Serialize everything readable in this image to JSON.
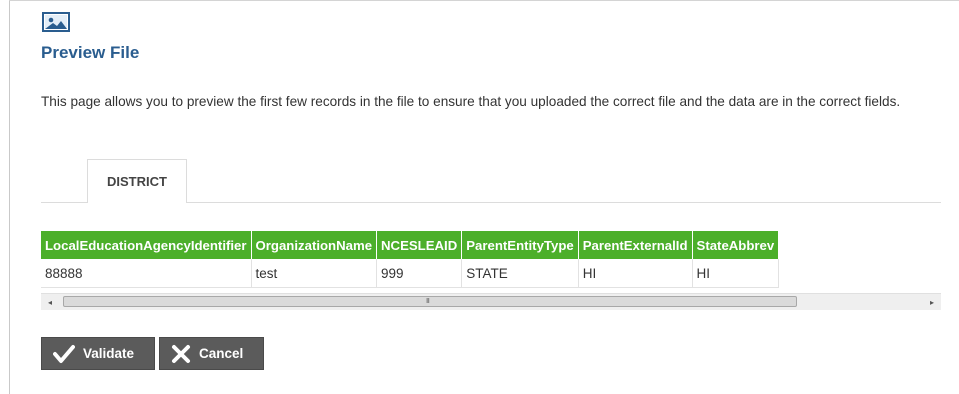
{
  "page": {
    "title": "Preview File",
    "description": "This page allows you to preview the first few records in the file to ensure that you uploaded the correct file and the data are in the correct fields.",
    "icon": "image-placeholder-icon"
  },
  "tabs": [
    {
      "label": "DISTRICT",
      "active": true
    }
  ],
  "table": {
    "header_color": "#4caf2a",
    "columns": [
      "LocalEducationAgencyIdentifier",
      "OrganizationName",
      "NCESLEAID",
      "ParentEntityType",
      "ParentExternalId",
      "StateAbbrev"
    ],
    "rows": [
      [
        "88888",
        "test",
        "999",
        "STATE",
        "HI",
        "HI"
      ]
    ],
    "scrollbar": {
      "grip": "III",
      "left_arrow": "◂",
      "right_arrow": "▸"
    }
  },
  "actions": {
    "validate_label": "Validate",
    "validate_icon": "check-icon",
    "cancel_label": "Cancel",
    "cancel_icon": "close-icon",
    "button_color": "#5b5b5b"
  }
}
